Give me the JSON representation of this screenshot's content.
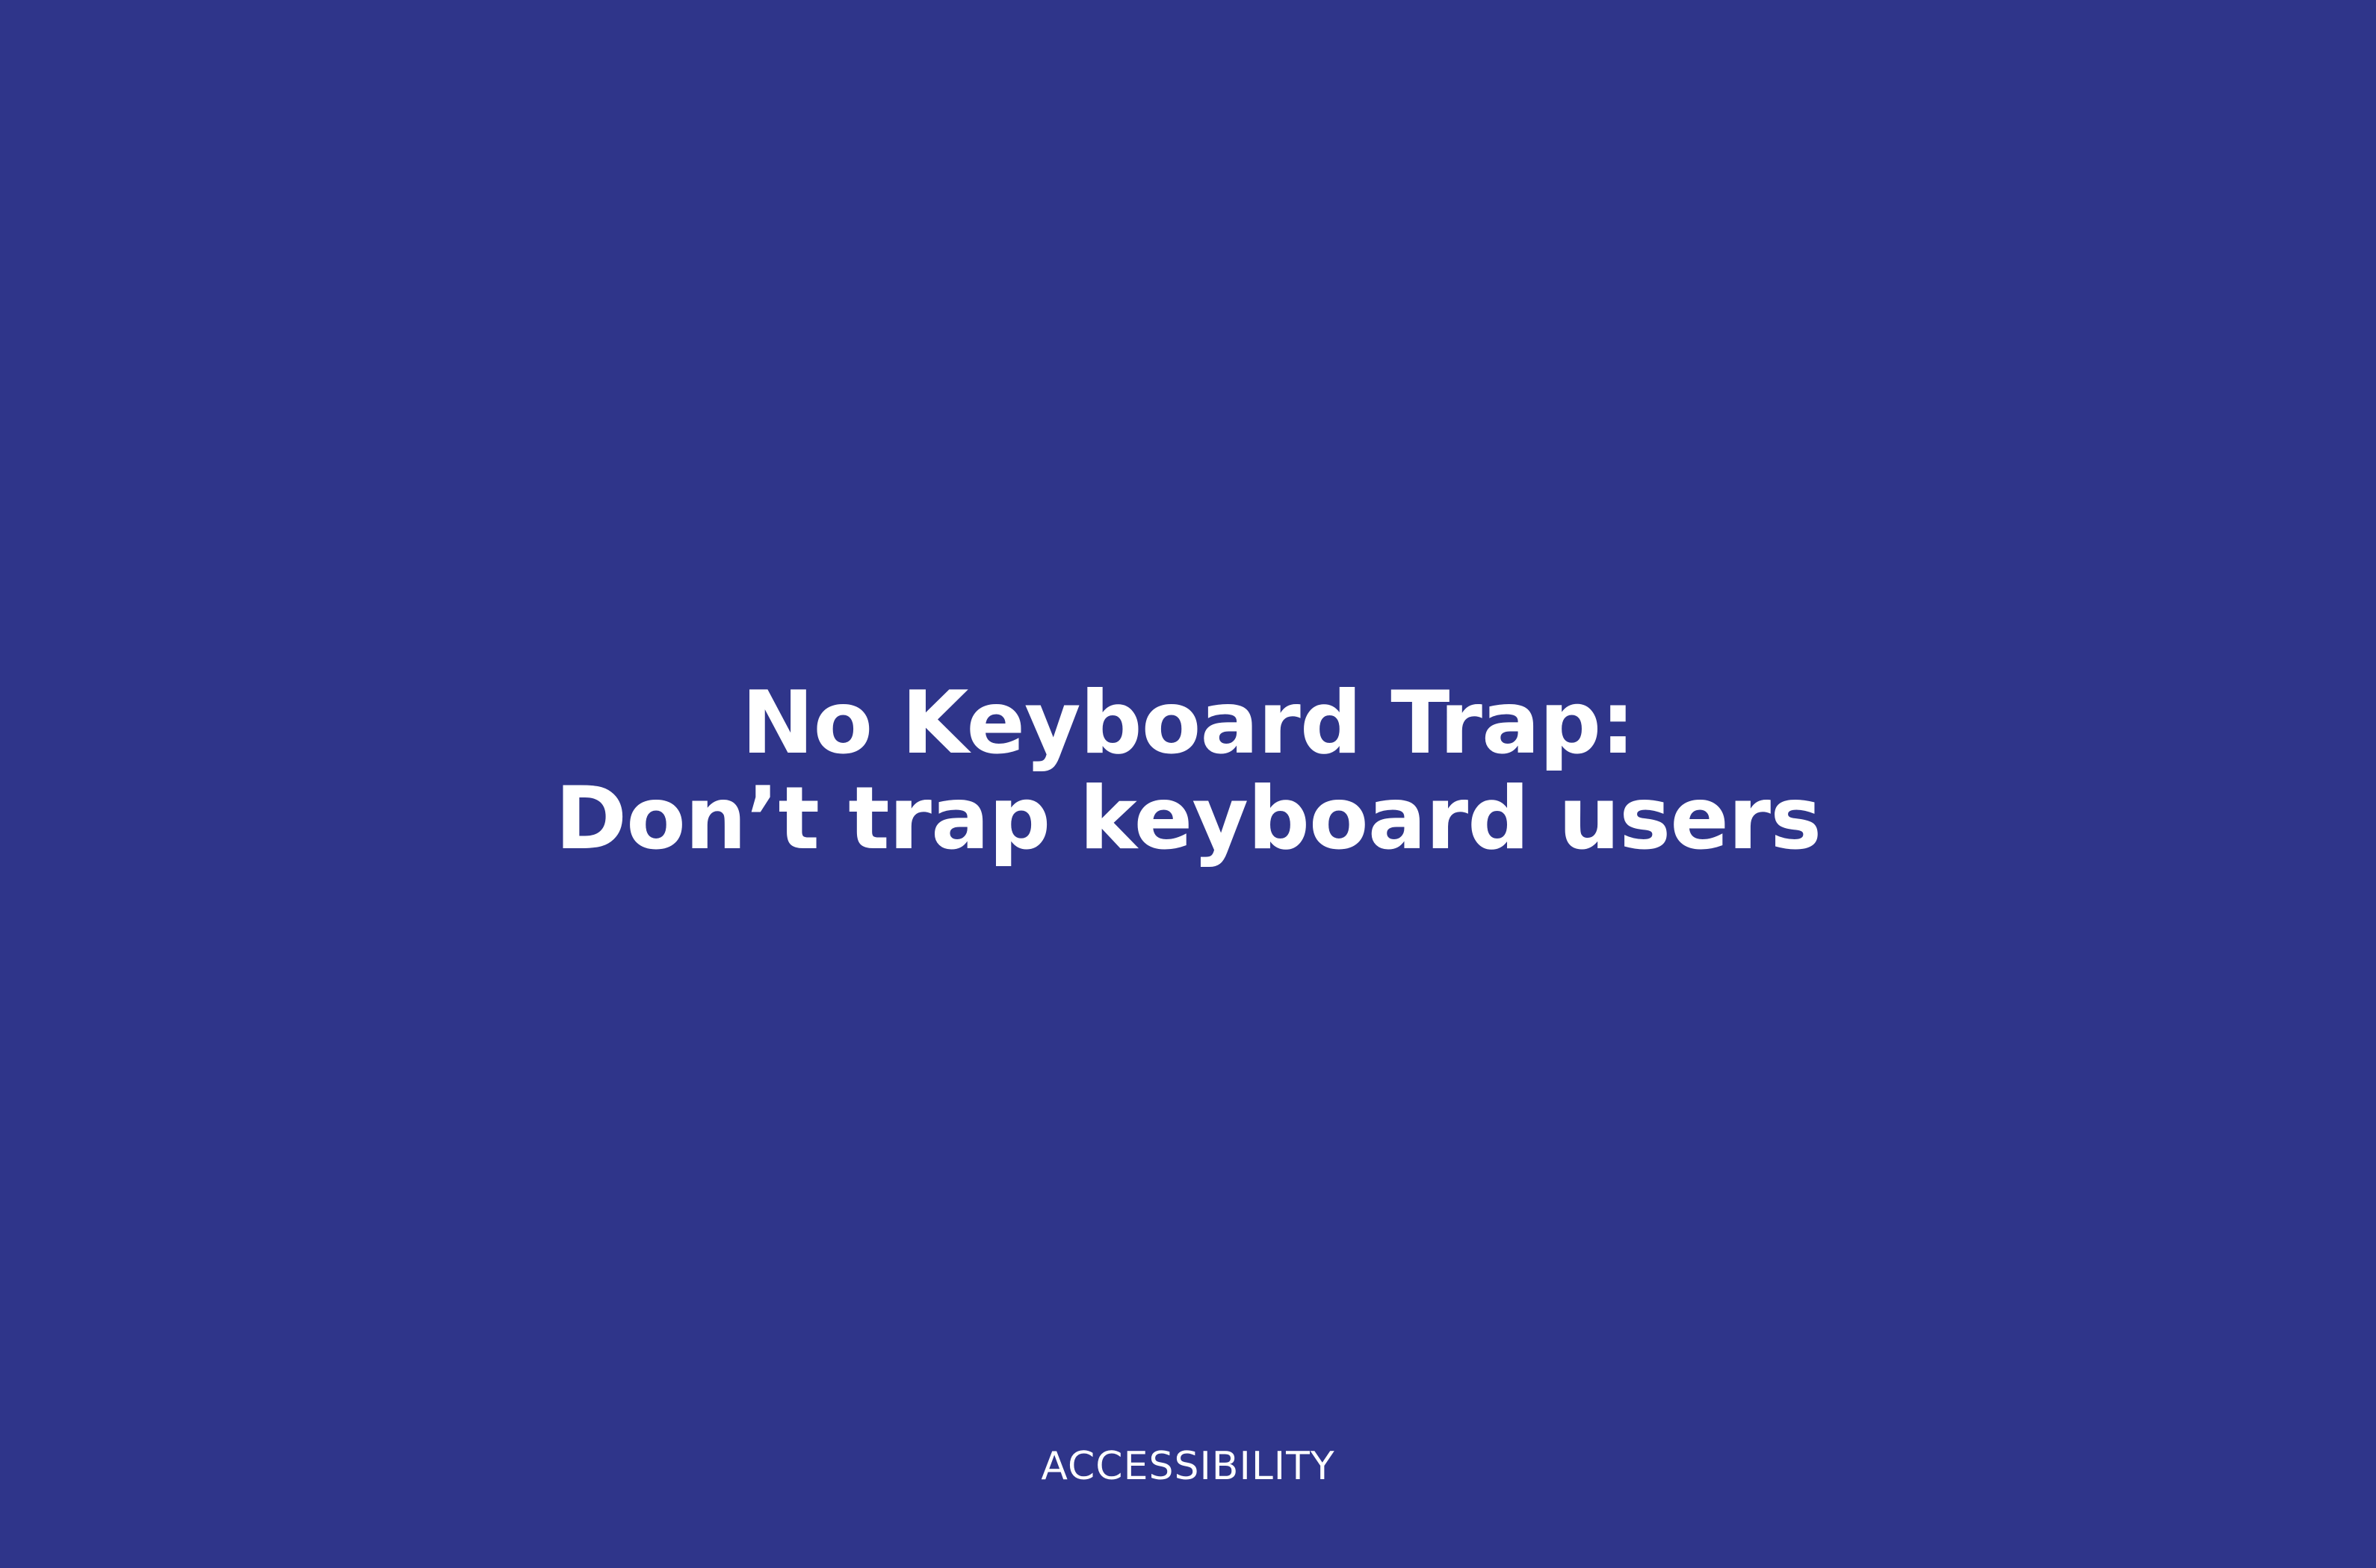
{
  "slide": {
    "background_color": "#2f358a",
    "text_color": "#ffffff",
    "title": {
      "line1": "No Keyboard Trap:",
      "line2": "Don’t trap keyboard users"
    },
    "footer_label": "ACCESSIBILITY"
  }
}
